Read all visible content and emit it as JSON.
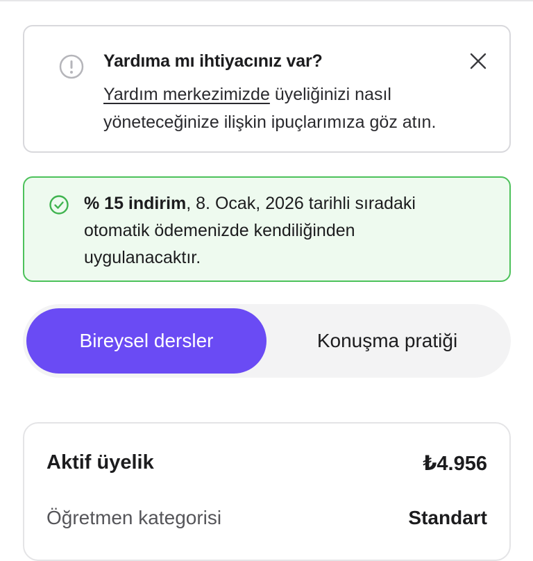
{
  "help": {
    "title": "Yardıma mı ihtiyacınız var?",
    "link_text": "Yardım merkezimizde",
    "body_rest": " üyeliğinizi nasıl yöneteceğinize ilişkin ipuçlarımıza göz atın.",
    "icon": "info-circle-icon",
    "close_icon": "close-icon"
  },
  "promo": {
    "discount": "% 15 indirim",
    "message": ", 8. Ocak, 2026 tarihli sıradaki otomatik ödemenizde kendiliğinden uygulanacaktır.",
    "icon": "check-circle-icon",
    "accent": "#4cc15a"
  },
  "tabs": {
    "active": "Bireysel dersler",
    "inactive": "Konuşma pratiği",
    "accent": "#6a4bf4"
  },
  "membership": {
    "label": "Aktif üyelik",
    "price": "₺4.956",
    "category_label": "Öğretmen kategorisi",
    "category_value": "Standart"
  }
}
